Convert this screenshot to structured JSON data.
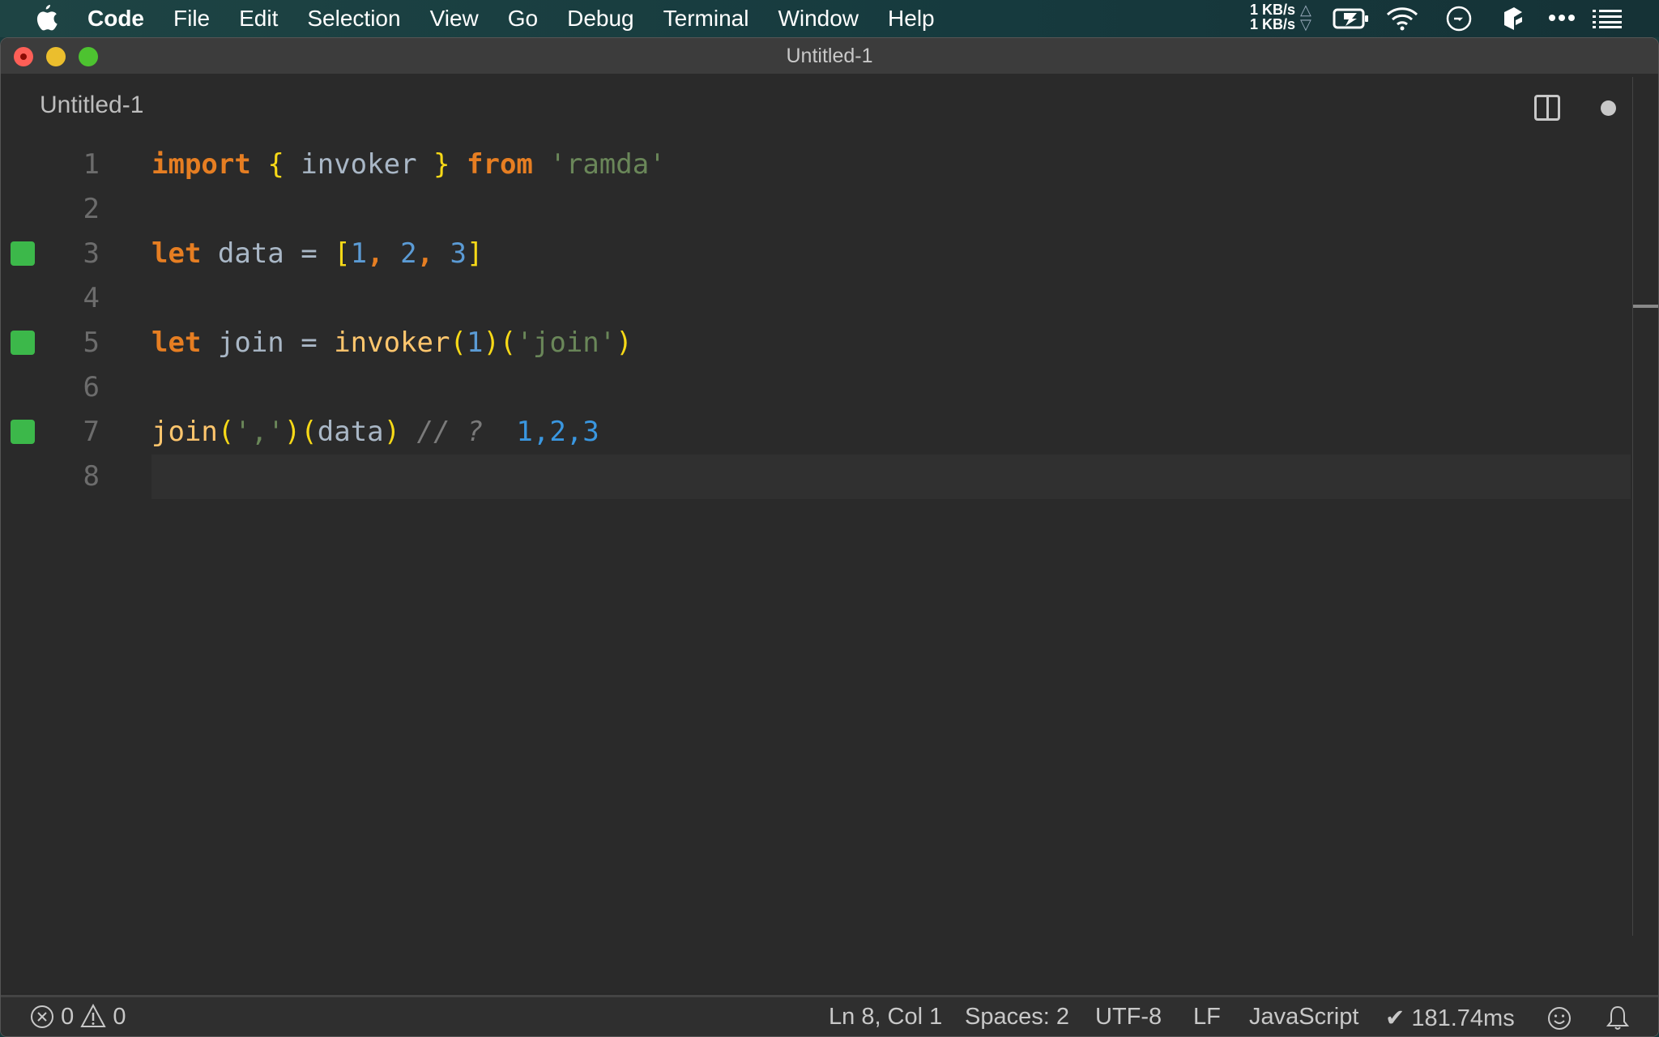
{
  "menubar": {
    "apple_icon": "apple-logo-icon",
    "items": [
      "Code",
      "File",
      "Edit",
      "Selection",
      "View",
      "Go",
      "Debug",
      "Terminal",
      "Window",
      "Help"
    ],
    "net_up": "1 KB/s",
    "net_down": "1 KB/s",
    "tray_icons": [
      "battery-charging-icon",
      "wifi-icon",
      "clock-icon",
      "app-cube-icon",
      "more-dots-icon",
      "list-icon"
    ]
  },
  "window": {
    "title": "Untitled-1",
    "tab_label": "Untitled-1",
    "split_editor_icon": "split-editor-icon",
    "dirty_indicator": "unsaved-dot-icon"
  },
  "editor": {
    "language": "JavaScript",
    "lines": [
      {
        "number": "1",
        "marker": false,
        "tokens": [
          {
            "t": "import",
            "c": "kw"
          },
          {
            "t": " ",
            "c": "id"
          },
          {
            "t": "{",
            "c": "br"
          },
          {
            "t": " invoker ",
            "c": "id"
          },
          {
            "t": "}",
            "c": "br"
          },
          {
            "t": " ",
            "c": "id"
          },
          {
            "t": "from",
            "c": "kw"
          },
          {
            "t": " ",
            "c": "id"
          },
          {
            "t": "'ramda'",
            "c": "str"
          }
        ]
      },
      {
        "number": "2",
        "marker": false,
        "tokens": []
      },
      {
        "number": "3",
        "marker": true,
        "tokens": [
          {
            "t": "let",
            "c": "kw"
          },
          {
            "t": " data = ",
            "c": "id"
          },
          {
            "t": "[",
            "c": "br"
          },
          {
            "t": "1",
            "c": "num"
          },
          {
            "t": ", ",
            "c": "kw"
          },
          {
            "t": "2",
            "c": "num"
          },
          {
            "t": ", ",
            "c": "kw"
          },
          {
            "t": "3",
            "c": "num"
          },
          {
            "t": "]",
            "c": "br"
          }
        ]
      },
      {
        "number": "4",
        "marker": false,
        "tokens": []
      },
      {
        "number": "5",
        "marker": true,
        "tokens": [
          {
            "t": "let",
            "c": "kw"
          },
          {
            "t": " join = ",
            "c": "id"
          },
          {
            "t": "invoker",
            "c": "fn"
          },
          {
            "t": "(",
            "c": "br"
          },
          {
            "t": "1",
            "c": "num"
          },
          {
            "t": ")(",
            "c": "br"
          },
          {
            "t": "'join'",
            "c": "str"
          },
          {
            "t": ")",
            "c": "br"
          }
        ]
      },
      {
        "number": "6",
        "marker": false,
        "tokens": []
      },
      {
        "number": "7",
        "marker": true,
        "tokens": [
          {
            "t": "join",
            "c": "fn"
          },
          {
            "t": "(",
            "c": "br"
          },
          {
            "t": "','",
            "c": "str"
          },
          {
            "t": ")(",
            "c": "br"
          },
          {
            "t": "data",
            "c": "id"
          },
          {
            "t": ")",
            "c": "br"
          },
          {
            "t": " // ?  ",
            "c": "cm"
          },
          {
            "t": "1,2,3",
            "c": "res"
          }
        ]
      },
      {
        "number": "8",
        "marker": false,
        "current": true,
        "tokens": []
      }
    ]
  },
  "statusbar": {
    "errors": "0",
    "warnings": "0",
    "cursor": "Ln 8, Col 1",
    "indent": "Spaces: 2",
    "encoding": "UTF-8",
    "eol": "LF",
    "language": "JavaScript",
    "timing": "✔ 181.74ms",
    "feedback_icon": "smiley-icon",
    "notifications_icon": "bell-icon"
  }
}
